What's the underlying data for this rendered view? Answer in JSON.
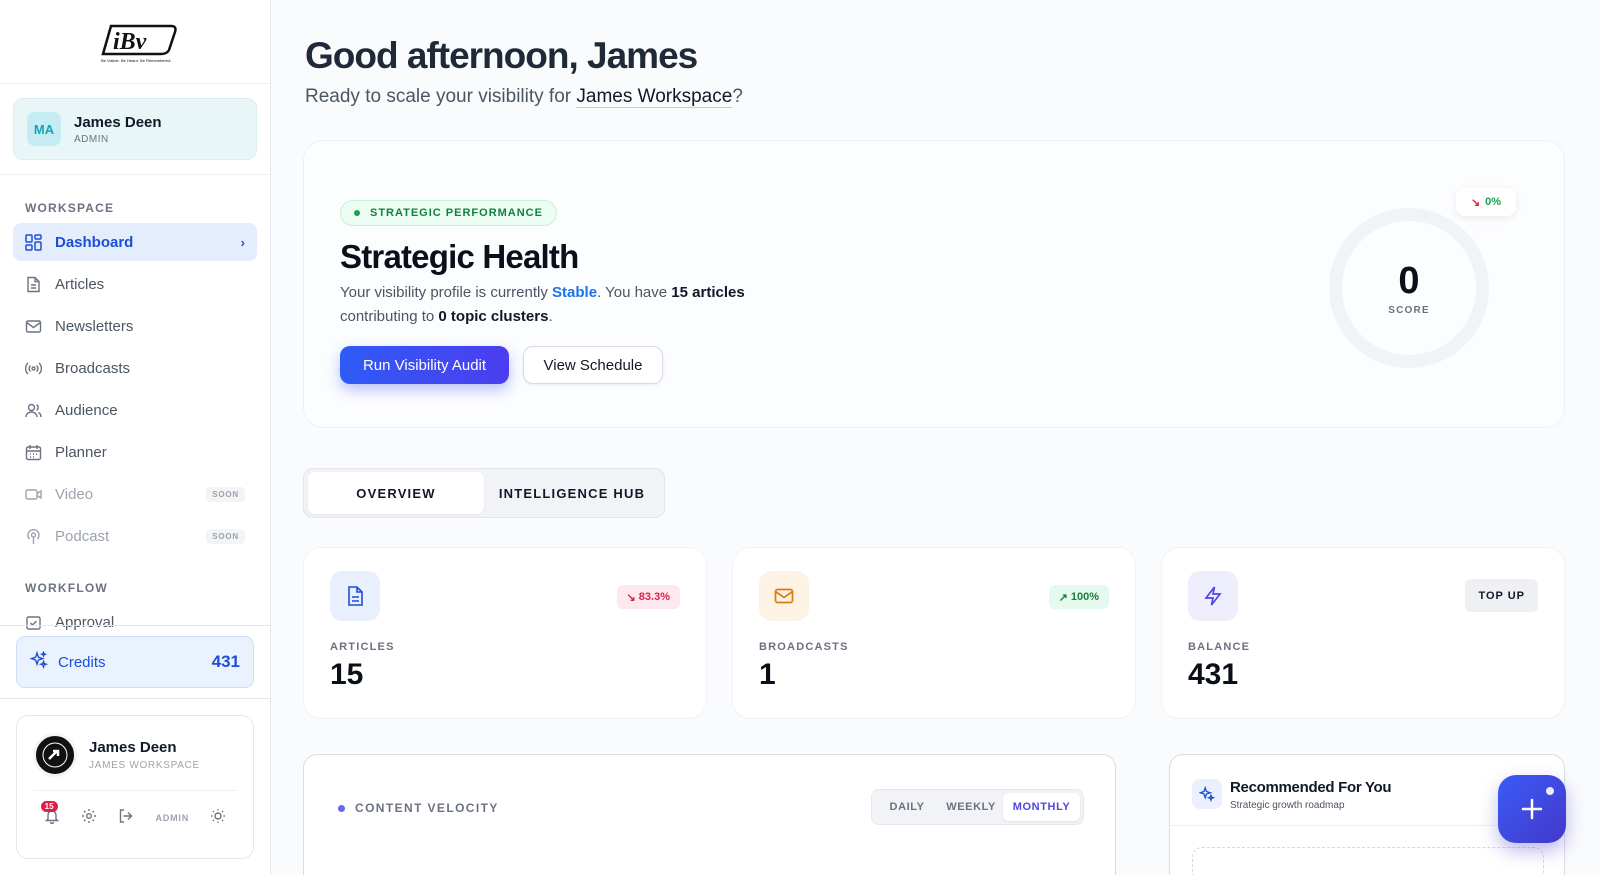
{
  "sidebar": {
    "logo_text": "iBv",
    "logo_tagline": "Be Visible. Be Heard. Be Remembered.",
    "user": {
      "initials": "MA",
      "name": "James Deen",
      "role": "ADMIN"
    },
    "sections": [
      {
        "label": "WORKSPACE"
      },
      {
        "label": "WORKFLOW"
      }
    ],
    "items": [
      {
        "label": "Dashboard",
        "icon": "dashboard-icon"
      },
      {
        "label": "Articles",
        "icon": "document-icon"
      },
      {
        "label": "Newsletters",
        "icon": "mail-icon"
      },
      {
        "label": "Broadcasts",
        "icon": "broadcast-icon"
      },
      {
        "label": "Audience",
        "icon": "users-icon"
      },
      {
        "label": "Planner",
        "icon": "calendar-icon"
      },
      {
        "label": "Video",
        "icon": "video-icon",
        "tag": "SOON"
      },
      {
        "label": "Podcast",
        "icon": "podcast-icon",
        "tag": "SOON"
      },
      {
        "label": "Approval",
        "icon": "approval-icon"
      }
    ],
    "credits": {
      "label": "Credits",
      "value": "431"
    },
    "account": {
      "name": "James Deen",
      "workspace": "JAMES WORKSPACE",
      "notifications": "15",
      "role": "ADMIN"
    }
  },
  "header": {
    "greeting": "Good afternoon, James",
    "sub_prefix": "Ready to scale your visibility for ",
    "workspace": "James Workspace",
    "sub_suffix": "?"
  },
  "hero": {
    "pill": "STRATEGIC PERFORMANCE",
    "title": "Strategic Health",
    "desc_1": "Your visibility profile is currently ",
    "status": "Stable",
    "desc_2": ". You have ",
    "articles": "15 articles",
    "desc_3": " contributing to ",
    "clusters": "0 topic clusters",
    "desc_4": ".",
    "primary_button": "Run Visibility Audit",
    "secondary_button": "View Schedule",
    "score": "0",
    "score_label": "SCORE",
    "trend": "0%"
  },
  "tabs": [
    {
      "label": "OVERVIEW"
    },
    {
      "label": "INTELLIGENCE HUB"
    }
  ],
  "stats": [
    {
      "label": "ARTICLES",
      "value": "15",
      "chip": "83.3%",
      "trend": "down"
    },
    {
      "label": "BROADCASTS",
      "value": "1",
      "chip": "100%",
      "trend": "up"
    },
    {
      "label": "BALANCE",
      "value": "431",
      "chip": "TOP UP"
    }
  ],
  "velocity": {
    "title": "CONTENT VELOCITY",
    "periods": [
      "DAILY",
      "WEEKLY",
      "MONTHLY"
    ],
    "selected": "MONTHLY"
  },
  "recommended": {
    "title": "Recommended For You",
    "subtitle": "Strategic growth roadmap"
  },
  "colors": {
    "accent": "#1d4ed8",
    "primary_gradient_start": "#2f5bf5",
    "success": "#16a34a",
    "danger": "#e11d48"
  }
}
